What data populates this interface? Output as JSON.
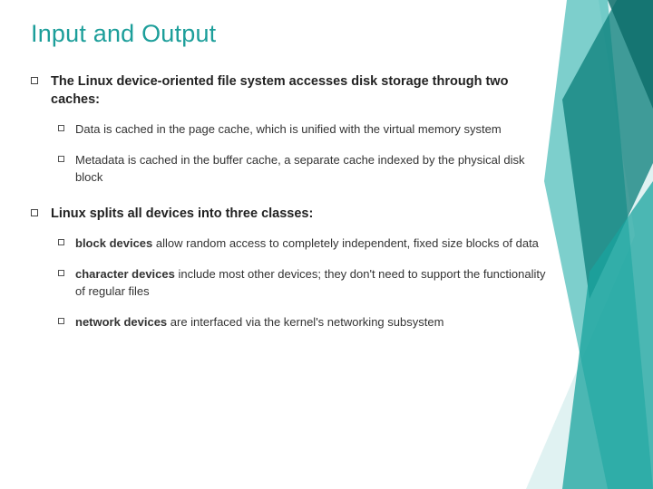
{
  "title": "Input and Output",
  "items": [
    {
      "text": "The Linux device-oriented file system accesses disk storage through two caches:",
      "sub": [
        {
          "text": "Data is cached in the page cache, which is unified with the virtual memory system"
        },
        {
          "text": "Metadata is cached in the buffer cache, a separate cache indexed by the physical disk block"
        }
      ]
    },
    {
      "text": "Linux splits all devices into three classes:",
      "sub": [
        {
          "bold": "block devices",
          "rest": " allow random access to completely independent, fixed size blocks of data"
        },
        {
          "bold": "character devices",
          "rest": " include most other devices; they don't need to support the functionality of regular files"
        },
        {
          "bold": "network devices",
          "rest": " are interfaced via the kernel's networking subsystem"
        }
      ]
    }
  ]
}
